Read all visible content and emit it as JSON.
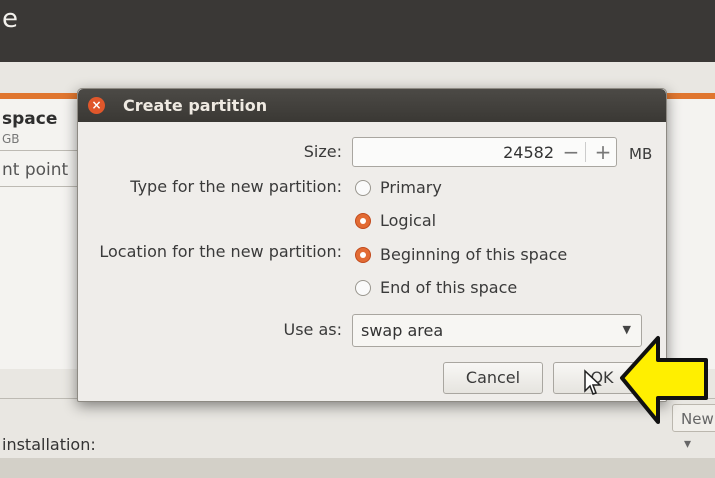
{
  "background": {
    "window_title": "e",
    "section_title": "space",
    "section_sub": "GB",
    "mount_label": "nt point",
    "new_button": "New",
    "install_label": "installation:"
  },
  "dialog": {
    "title": "Create partition",
    "size_label": "Size:",
    "size_value": "24582",
    "size_unit": "MB",
    "stepper_minus": "−",
    "stepper_plus": "+",
    "type_label": "Type for the new partition:",
    "type_options": [
      {
        "label": "Primary",
        "selected": false
      },
      {
        "label": "Logical",
        "selected": true
      }
    ],
    "location_label": "Location for the new partition:",
    "location_options": [
      {
        "label": "Beginning of this space",
        "selected": true
      },
      {
        "label": "End of this space",
        "selected": false
      }
    ],
    "use_as_label": "Use as:",
    "use_as_value": "swap area",
    "cancel_label": "Cancel",
    "ok_label": "OK"
  },
  "colors": {
    "accent": "#e26b34",
    "titlebar": "#3c3b37",
    "annotation_arrow": "#ffef00"
  }
}
